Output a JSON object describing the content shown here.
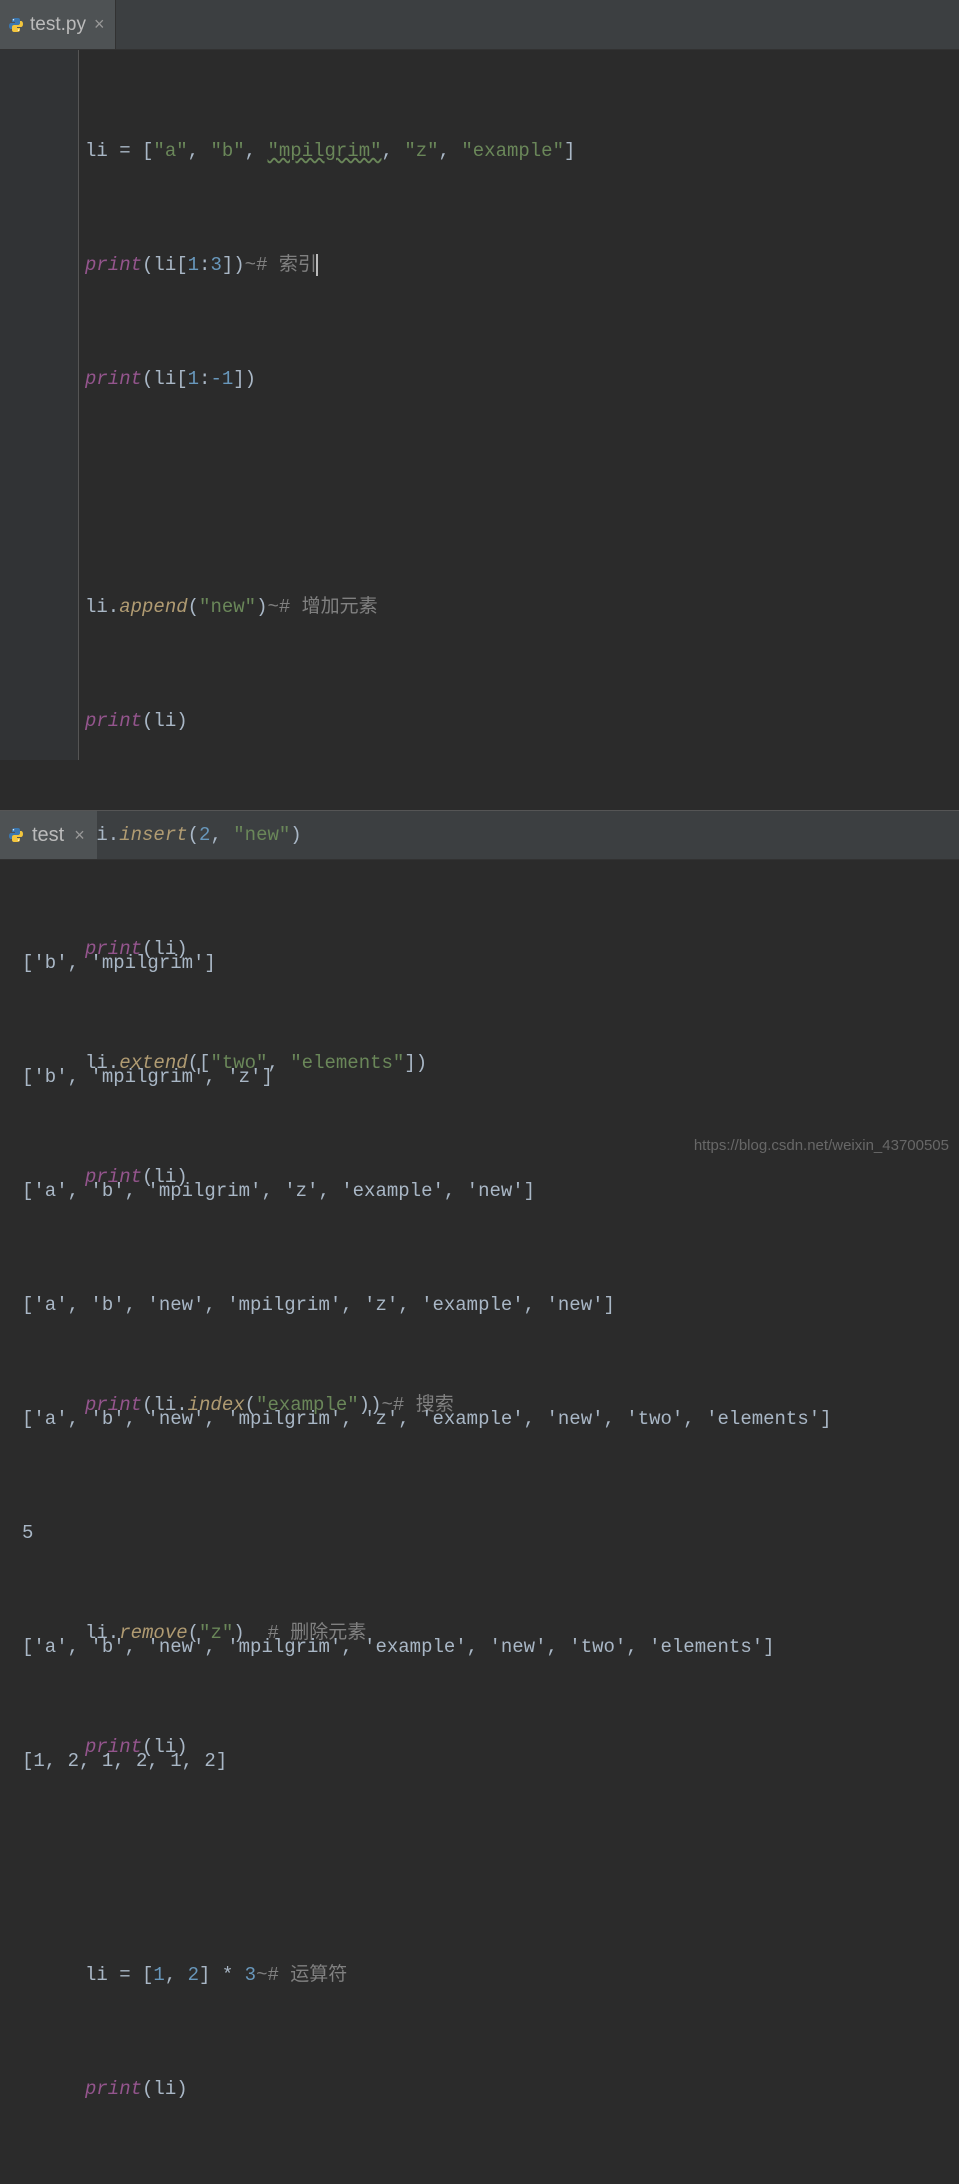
{
  "editor": {
    "tab": {
      "filename": "test.py",
      "close_tooltip": "Close"
    },
    "code": {
      "l1": {
        "a": "li = [",
        "s1": "\"a\"",
        "c1": ", ",
        "s2": "\"b\"",
        "c2": ", ",
        "s3": "\"mpilgrim\"",
        "c3": ", ",
        "s4": "\"z\"",
        "c4": ", ",
        "s5": "\"example\"",
        "b": "]"
      },
      "l2": {
        "p": "print",
        "a": "(li[",
        "n1": "1",
        "b": ":",
        "n2": "3",
        "c": "])",
        "tl": "~",
        "com": "# 索引"
      },
      "l3": {
        "p": "print",
        "a": "(li[",
        "n1": "1",
        "b": ":",
        "n2": "-1",
        "c": "])"
      },
      "l4": {
        "a": "li.",
        "m": "append",
        "b": "(",
        "s1": "\"new\"",
        "c": ")",
        "tl": "~",
        "com": "# 增加元素"
      },
      "l5": {
        "p": "print",
        "a": "(li)"
      },
      "l6": {
        "a": "li.",
        "m": "insert",
        "b": "(",
        "n1": "2",
        "c": ", ",
        "s1": "\"new\"",
        "d": ")"
      },
      "l7": {
        "p": "print",
        "a": "(li)"
      },
      "l8": {
        "a": "li.",
        "m": "extend",
        "b": "([",
        "s1": "\"two\"",
        "c": ", ",
        "s2": "\"elements\"",
        "d": "])"
      },
      "l9": {
        "p": "print",
        "a": "(li)"
      },
      "l10": {
        "p": "print",
        "a": "(li.",
        "m": "index",
        "b": "(",
        "s1": "\"example\"",
        "c": "))",
        "tl": "~",
        "com": "# 搜索"
      },
      "l11": {
        "a": "li.",
        "m": "remove",
        "b": "(",
        "s1": "\"z\"",
        "c": ")  ",
        "com": "# 删除元素"
      },
      "l12": {
        "p": "print",
        "a": "(li)"
      },
      "l13": {
        "a": "li = [",
        "n1": "1",
        "b": ", ",
        "n2": "2",
        "c": "] * ",
        "n3": "3",
        "tl": "~",
        "com": "# 运算符"
      },
      "l14": {
        "p": "print",
        "a": "(li)"
      }
    }
  },
  "console": {
    "tab": {
      "name": "test",
      "close_tooltip": "Close"
    },
    "out": {
      "o1": "['b', 'mpilgrim']",
      "o2": "['b', 'mpilgrim', 'z']",
      "o3": "['a', 'b', 'mpilgrim', 'z', 'example', 'new']",
      "o4": "['a', 'b', 'new', 'mpilgrim', 'z', 'example', 'new']",
      "o5": "['a', 'b', 'new', 'mpilgrim', 'z', 'example', 'new', 'two', 'elements']",
      "o6": "5",
      "o7": "['a', 'b', 'new', 'mpilgrim', 'example', 'new', 'two', 'elements']",
      "o8": "[1, 2, 1, 2, 1, 2]"
    }
  },
  "watermark": "https://blog.csdn.net/weixin_43700505"
}
